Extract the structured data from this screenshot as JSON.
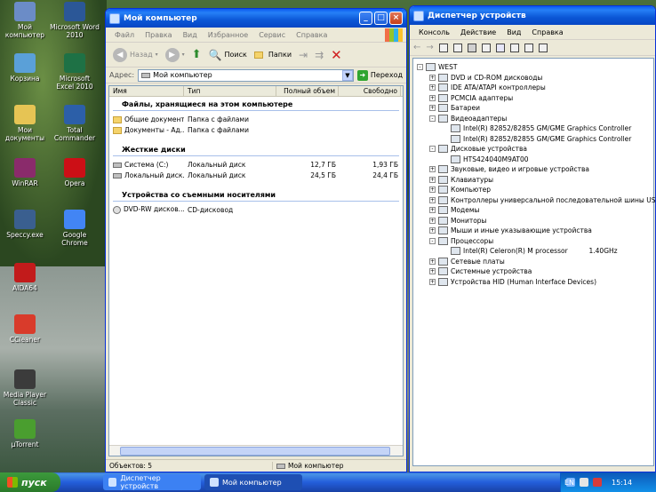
{
  "desktop": {
    "icons": [
      {
        "label": "Мой компьютер",
        "icon": "computer-icon",
        "color": "#6b8cc7"
      },
      {
        "label": "Microsoft Word 2010",
        "icon": "word-icon",
        "color": "#2b5797"
      },
      {
        "label": "Корзина",
        "icon": "recycle-bin-icon",
        "color": "#5aa0d8"
      },
      {
        "label": "Microsoft Excel 2010",
        "icon": "excel-icon",
        "color": "#1e7145"
      },
      {
        "label": "Мои документы",
        "icon": "my-documents-icon",
        "color": "#e6c454"
      },
      {
        "label": "Total Commander",
        "icon": "total-commander-icon",
        "color": "#2c5fa8"
      },
      {
        "label": "WinRAR",
        "icon": "winrar-icon",
        "color": "#8a2b6b"
      },
      {
        "label": "Opera",
        "icon": "opera-icon",
        "color": "#cc0f16"
      },
      {
        "label": "Speccy.exe",
        "icon": "speccy-icon",
        "color": "#3a5f8f"
      },
      {
        "label": "Google Chrome",
        "icon": "chrome-icon",
        "color": "#4285f4"
      },
      {
        "label": "AIDA64",
        "icon": "aida64-icon",
        "color": "#c21b1b"
      },
      {
        "label": "CCleaner",
        "icon": "ccleaner-icon",
        "color": "#d93b2b"
      },
      {
        "label": "Media Player Classic",
        "icon": "media-player-icon",
        "color": "#3b3b3b"
      },
      {
        "label": "µTorrent",
        "icon": "utorrent-icon",
        "color": "#4a9e2f"
      }
    ]
  },
  "explorer": {
    "title": "Мой компьютер",
    "menu": [
      "Файл",
      "Правка",
      "Вид",
      "Избранное",
      "Сервис",
      "Справка"
    ],
    "toolbar": {
      "back": "Назад",
      "search": "Поиск",
      "folders": "Папки"
    },
    "address_label": "Адрес:",
    "address_value": "Мой компьютер",
    "go_label": "Переход",
    "columns": [
      "Имя",
      "Тип",
      "Полный объем",
      "Свободно"
    ],
    "groups": [
      {
        "title": "Файлы, хранящиеся на этом компьютере",
        "rows": [
          {
            "name": "Общие документы",
            "type": "Папка с файлами",
            "total": "",
            "free": "",
            "kind": "folder"
          },
          {
            "name": "Документы - Ад...",
            "type": "Папка с файлами",
            "total": "",
            "free": "",
            "kind": "folder"
          }
        ]
      },
      {
        "title": "Жесткие диски",
        "rows": [
          {
            "name": "Система (C:)",
            "type": "Локальный диск",
            "total": "12,7 ГБ",
            "free": "1,93 ГБ",
            "kind": "disk"
          },
          {
            "name": "Локальный диск...",
            "type": "Локальный диск",
            "total": "24,5 ГБ",
            "free": "24,4 ГБ",
            "kind": "disk"
          }
        ]
      },
      {
        "title": "Устройства со съемными носителями",
        "rows": [
          {
            "name": "DVD-RW дисков...",
            "type": "CD-дисковод",
            "total": "",
            "free": "",
            "kind": "cd"
          }
        ]
      }
    ],
    "status_objects": "Объектов: 5",
    "status_location": "Мой компьютер"
  },
  "devmgr": {
    "title": "Диспетчер устройств",
    "menu": [
      "Консоль",
      "Действие",
      "Вид",
      "Справка"
    ],
    "tree": [
      {
        "label": "WEST",
        "level": 0,
        "pm": "-"
      },
      {
        "label": "DVD и CD-ROM дисководы",
        "level": 1,
        "pm": "+"
      },
      {
        "label": "IDE ATA/ATAPI контроллеры",
        "level": 1,
        "pm": "+"
      },
      {
        "label": "PCMCIA адаптеры",
        "level": 1,
        "pm": "+"
      },
      {
        "label": "Батареи",
        "level": 1,
        "pm": "+"
      },
      {
        "label": "Видеоадаптеры",
        "level": 1,
        "pm": "-"
      },
      {
        "label": "Intel(R) 82852/82855 GM/GME Graphics Controller",
        "level": 2,
        "pm": ""
      },
      {
        "label": "Intel(R) 82852/82855 GM/GME Graphics Controller",
        "level": 2,
        "pm": ""
      },
      {
        "label": "Дисковые устройства",
        "level": 1,
        "pm": "-"
      },
      {
        "label": "HTS424040M9AT00",
        "level": 2,
        "pm": ""
      },
      {
        "label": "Звуковые, видео и игровые устройства",
        "level": 1,
        "pm": "+"
      },
      {
        "label": "Клавиатуры",
        "level": 1,
        "pm": "+"
      },
      {
        "label": "Компьютер",
        "level": 1,
        "pm": "+"
      },
      {
        "label": "Контроллеры универсальной последовательной шины USB",
        "level": 1,
        "pm": "+"
      },
      {
        "label": "Модемы",
        "level": 1,
        "pm": "+"
      },
      {
        "label": "Мониторы",
        "level": 1,
        "pm": "+"
      },
      {
        "label": "Мыши и иные указывающие устройства",
        "level": 1,
        "pm": "+"
      },
      {
        "label": "Процессоры",
        "level": 1,
        "pm": "-"
      },
      {
        "label": "Intel(R) Celeron(R) M processor          1.40GHz",
        "level": 2,
        "pm": ""
      },
      {
        "label": "Сетевые платы",
        "level": 1,
        "pm": "+"
      },
      {
        "label": "Системные устройства",
        "level": 1,
        "pm": "+"
      },
      {
        "label": "Устройства HID (Human Interface Devices)",
        "level": 1,
        "pm": "+"
      }
    ]
  },
  "taskbar": {
    "start": "пуск",
    "tasks": [
      "Диспетчер устройств",
      "Мой компьютер"
    ],
    "lang": "EN",
    "clock": "15:14"
  }
}
